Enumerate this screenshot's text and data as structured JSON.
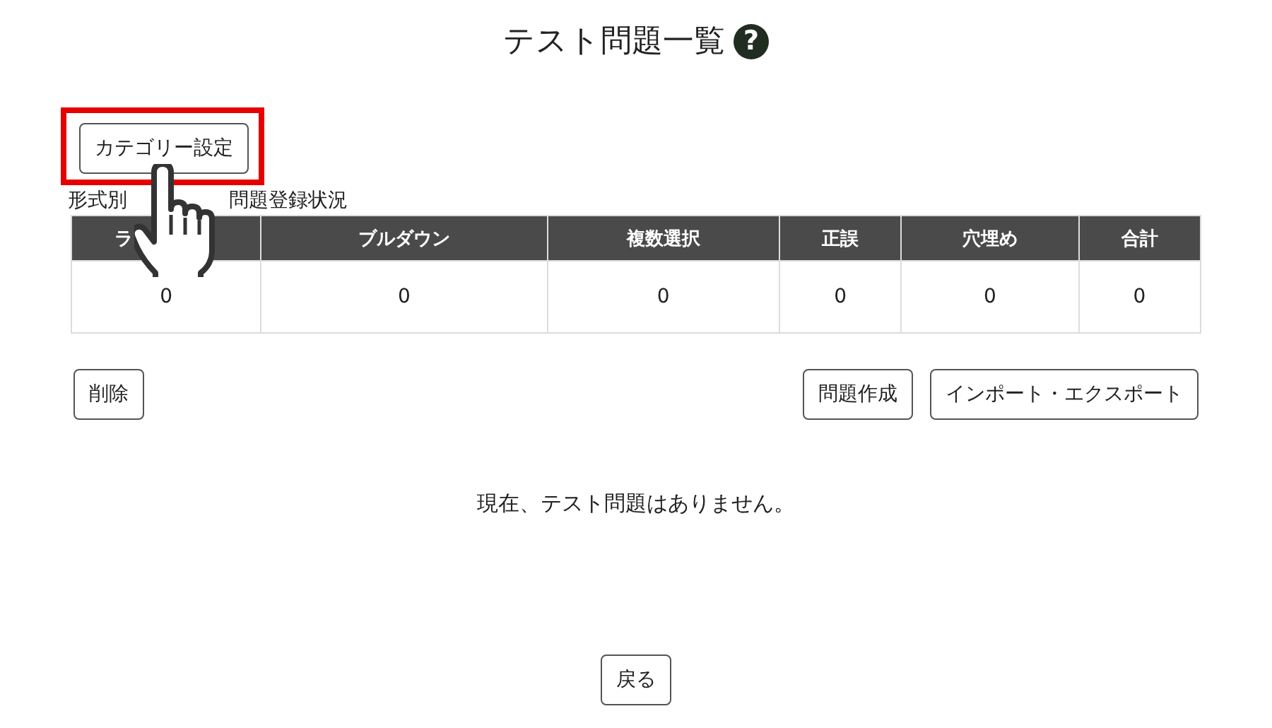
{
  "title": "テスト問題一覧",
  "help": {
    "label": "?"
  },
  "category_button": {
    "label": "カテゴリー設定",
    "highlighted": true
  },
  "caption": [
    "形式別",
    "問題登録状況"
  ],
  "table": {
    "columns": [
      "ラ",
      "ブルダウン",
      "複数選択",
      "正誤",
      "穴埋め",
      "合計"
    ],
    "rows": [
      [
        "0",
        "0",
        "0",
        "0",
        "0",
        "0"
      ]
    ]
  },
  "buttons_left": [
    "削除"
  ],
  "buttons_right": [
    "問題作成",
    "インポート・エクスポート"
  ],
  "message": "現在、テスト問題はありません。",
  "back_button": "戻る",
  "cursor": {
    "kind": "hand"
  }
}
